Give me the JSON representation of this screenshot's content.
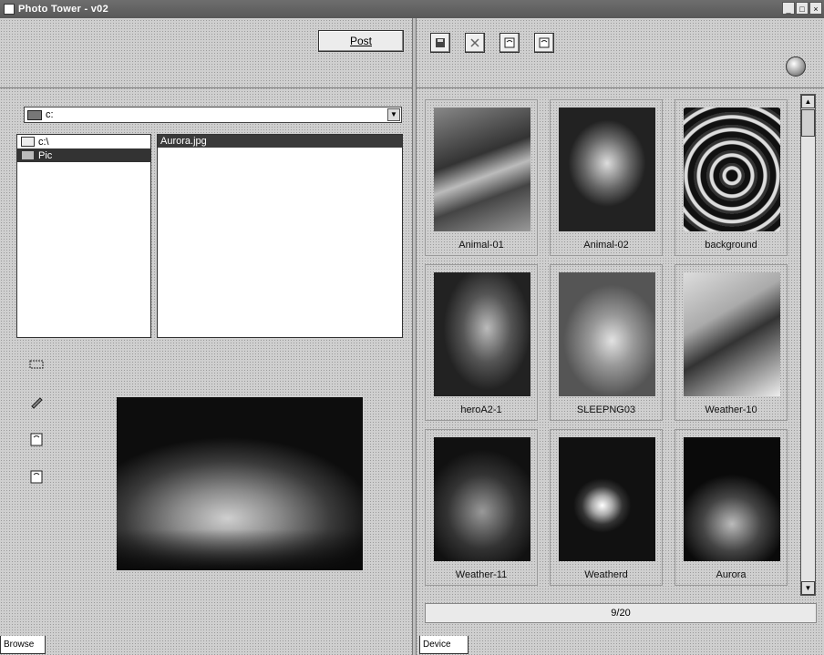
{
  "window": {
    "title": "Photo Tower - v02"
  },
  "left_toolbar": {
    "post_label": "Post"
  },
  "browse": {
    "drive": "c:",
    "folders": [
      {
        "label": "c:\\"
      },
      {
        "label": "Pic"
      }
    ],
    "files": [
      "Aurora.jpg"
    ]
  },
  "preview": {
    "image_name": "Aurora"
  },
  "tabs": {
    "browse": "Browse",
    "device": "Device"
  },
  "thumbnails": [
    {
      "label": "Animal-01",
      "icon": "image-thumbnail"
    },
    {
      "label": "Animal-02",
      "icon": "image-thumbnail"
    },
    {
      "label": "background",
      "icon": "image-thumbnail"
    },
    {
      "label": "heroA2-1",
      "icon": "image-thumbnail"
    },
    {
      "label": "SLEEPNG03",
      "icon": "image-thumbnail"
    },
    {
      "label": "Weather-10",
      "icon": "image-thumbnail"
    },
    {
      "label": "Weather-11",
      "icon": "image-thumbnail"
    },
    {
      "label": "Weatherd",
      "icon": "image-thumbnail"
    },
    {
      "label": "Aurora",
      "icon": "image-thumbnail"
    }
  ],
  "device": {
    "page_counter": "9/20"
  }
}
